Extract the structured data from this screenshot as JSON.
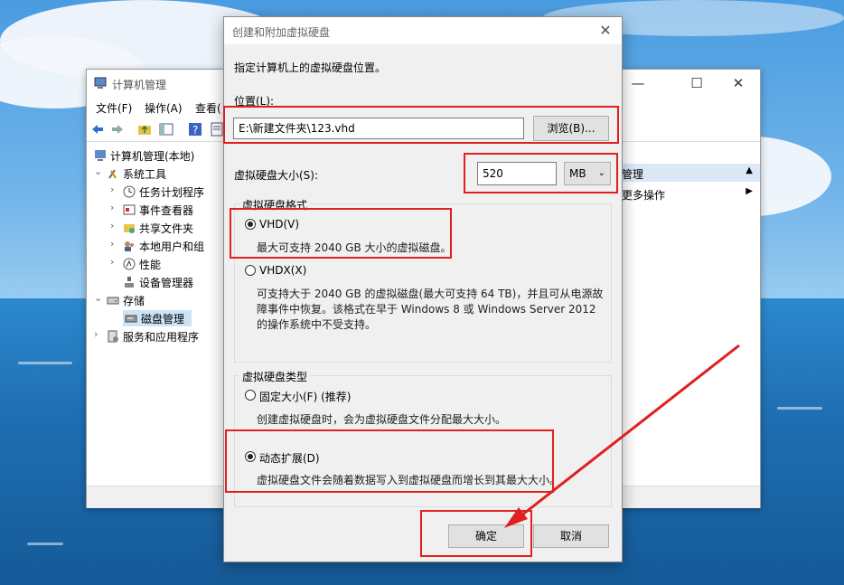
{
  "background_window": {
    "title": "计算机管理",
    "menu": [
      "文件(F)",
      "操作(A)",
      "查看("
    ],
    "tree": [
      {
        "label": "计算机管理(本地)",
        "level": 0,
        "arrow": "",
        "icon": "computer-management-icon"
      },
      {
        "label": "系统工具",
        "level": 1,
        "arrow": "⌄",
        "icon": "tools-icon"
      },
      {
        "label": "任务计划程序",
        "level": 2,
        "arrow": "›",
        "icon": "clock-icon"
      },
      {
        "label": "事件查看器",
        "level": 2,
        "arrow": "›",
        "icon": "event-viewer-icon"
      },
      {
        "label": "共享文件夹",
        "level": 2,
        "arrow": "›",
        "icon": "shared-folder-icon"
      },
      {
        "label": "本地用户和组",
        "level": 2,
        "arrow": "›",
        "icon": "users-icon"
      },
      {
        "label": "性能",
        "level": 2,
        "arrow": "›",
        "icon": "performance-icon"
      },
      {
        "label": "设备管理器",
        "level": 2,
        "arrow": "",
        "icon": "device-manager-icon"
      },
      {
        "label": "存储",
        "level": 1,
        "arrow": "⌄",
        "icon": "storage-icon"
      },
      {
        "label": "磁盘管理",
        "level": 2,
        "arrow": "",
        "icon": "disk-icon",
        "selected": true
      },
      {
        "label": "服务和应用程序",
        "level": 1,
        "arrow": "›",
        "icon": "services-icon"
      }
    ],
    "actions_header": "管理",
    "actions_more": "更多操作"
  },
  "dialog": {
    "title": "创建和附加虚拟硬盘",
    "intro": "指定计算机上的虚拟硬盘位置。",
    "location_label": "位置(L):",
    "location_value": "E:\\新建文件夹\\123.vhd",
    "browse_button": "浏览(B)...",
    "size_label": "虚拟硬盘大小(S):",
    "size_value": "520",
    "size_unit": "MB",
    "format_group": "虚拟硬盘格式",
    "vhd_label": "VHD(V)",
    "vhd_desc": "最大可支持 2040 GB 大小的虚拟磁盘。",
    "vhdx_label": "VHDX(X)",
    "vhdx_desc_1": "可支持大于 2040 GB 的虚拟磁盘(最大可支持 64 TB)，并且可从电源故",
    "vhdx_desc_2": "障事件中恢复。该格式在早于 Windows 8 或 Windows Server 2012",
    "vhdx_desc_3": "的操作系统中不受支持。",
    "type_group": "虚拟硬盘类型",
    "fixed_label": "固定大小(F) (推荐)",
    "fixed_desc": "创建虚拟硬盘时，会为虚拟硬盘文件分配最大大小。",
    "dynamic_label": "动态扩展(D)",
    "dynamic_desc": "虚拟硬盘文件会随着数据写入到虚拟硬盘而增长到其最大大小。",
    "ok_button": "确定",
    "cancel_button": "取消",
    "selected_format": "VHD",
    "selected_type": "动态扩展"
  },
  "colors": {
    "highlight": "#e02020",
    "dialog_bg": "#f0f0f0",
    "selection": "#cce4f7"
  }
}
